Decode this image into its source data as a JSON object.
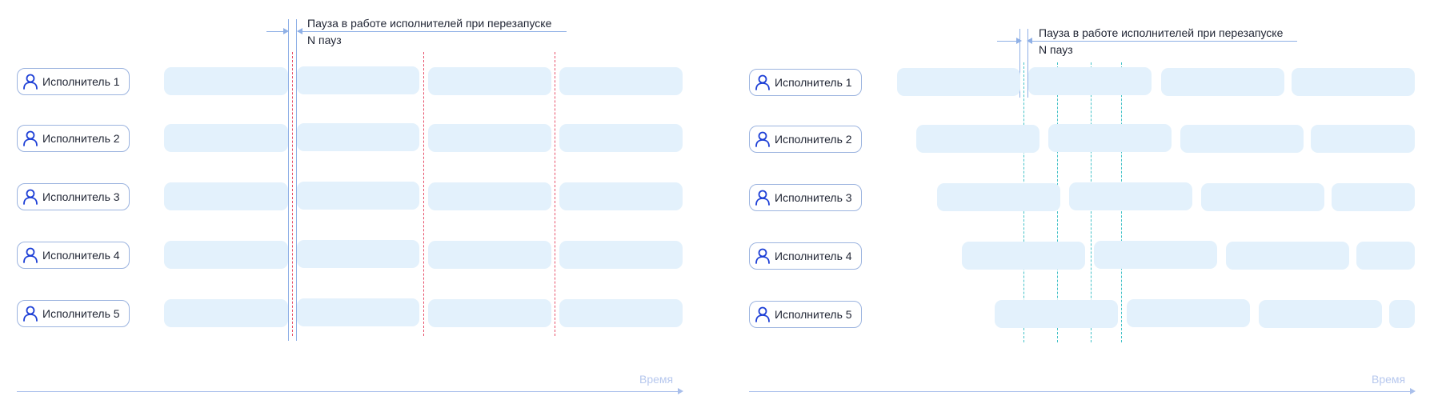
{
  "executors": [
    {
      "label": "Исполнитель 1"
    },
    {
      "label": "Исполнитель 2"
    },
    {
      "label": "Исполнитель 3"
    },
    {
      "label": "Исполнитель 4"
    },
    {
      "label": "Исполнитель 5"
    }
  ],
  "pause_annotation": "Пауза в работе исполнителей при перезапуске",
  "pause_count_annotation": "N пауз",
  "time_axis_label": "Время",
  "icons": {
    "executor": "person-icon"
  },
  "colors": {
    "task_bar": "#e3f1fc",
    "outline": "#9bb3df",
    "restart_line": "#e8506a",
    "rolling_restart_line": "#43c2c8",
    "axis": "#a9bfeb"
  }
}
